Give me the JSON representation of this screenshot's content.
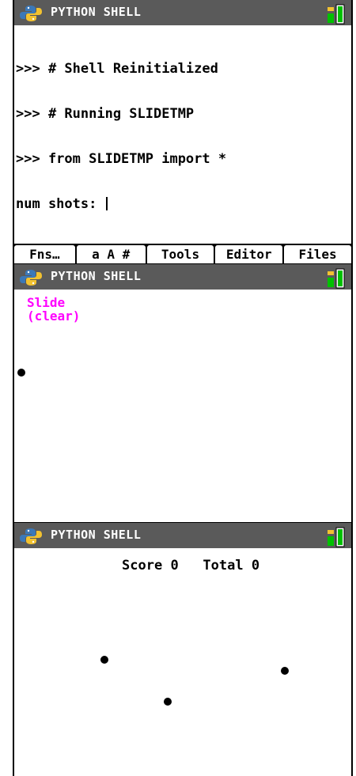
{
  "title": "PYTHON SHELL",
  "shell": {
    "lines": [
      ">>> # Shell Reinitialized",
      ">>> # Running SLIDETMP",
      ">>> from SLIDETMP import *",
      "num shots: "
    ]
  },
  "menu": {
    "fns": "Fns…",
    "chars": "a A #",
    "tools": "Tools",
    "editor": "Editor",
    "files": "Files"
  },
  "slide": {
    "line1": "Slide",
    "line2": "(clear)"
  },
  "game": {
    "score_label": "Score",
    "score_value": "0",
    "total_label": "Total",
    "total_value": "0"
  },
  "colors": {
    "titlebar": "#5a5a5a",
    "slide_text": "#ff00ff",
    "battery": "#00c000"
  },
  "icons": {
    "python": "python-logo-icon",
    "battery": "battery-icon"
  }
}
